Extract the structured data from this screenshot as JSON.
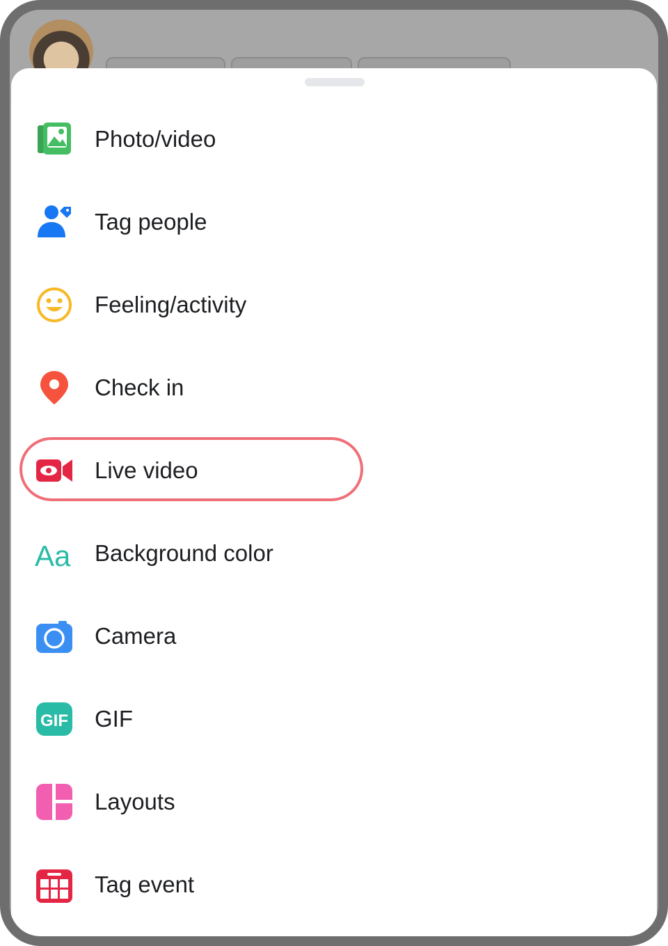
{
  "composer_menu": {
    "items": [
      {
        "label": "Photo/video",
        "icon": "photo-video-icon",
        "color": "#45bd62"
      },
      {
        "label": "Tag people",
        "icon": "tag-people-icon",
        "color": "#1877f2"
      },
      {
        "label": "Feeling/activity",
        "icon": "feeling-icon",
        "color": "#f7b928"
      },
      {
        "label": "Check in",
        "icon": "check-in-icon",
        "color": "#f5533d"
      },
      {
        "label": "Live video",
        "icon": "live-video-icon",
        "color": "#e42645"
      },
      {
        "label": "Background color",
        "icon": "background-color-icon",
        "color": "#2abba7"
      },
      {
        "label": "Camera",
        "icon": "camera-icon",
        "color": "#3b8ff3"
      },
      {
        "label": "GIF",
        "icon": "gif-icon",
        "color": "#2abba7"
      },
      {
        "label": "Layouts",
        "icon": "layouts-icon",
        "color": "#f35fb0"
      },
      {
        "label": "Tag event",
        "icon": "tag-event-icon",
        "color": "#e42645"
      }
    ],
    "highlighted_item": "Live video",
    "highlight_color": "#ef6f78"
  }
}
